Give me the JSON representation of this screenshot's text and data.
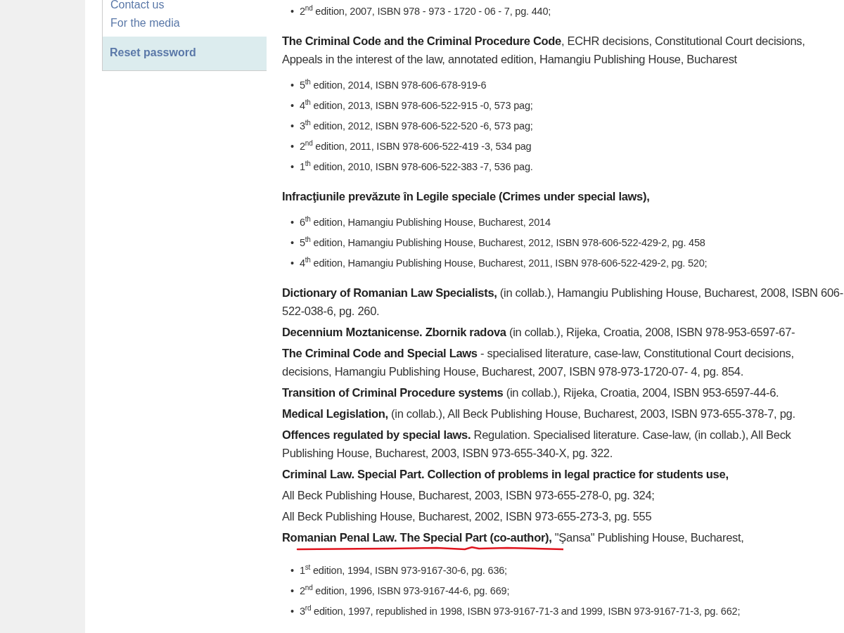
{
  "sidebar": {
    "links": [
      {
        "label": "Contact us"
      },
      {
        "label": "For the media"
      }
    ],
    "reset_link": {
      "label": "Reset password"
    }
  },
  "content": [
    {
      "kind": "list",
      "bullet": "•",
      "items": [
        "2$^{nd}$ edition, 2007, ISBN 978 - 973 - 1720 - 06 - 7, pg. 440;"
      ]
    },
    {
      "kind": "para",
      "text": "**The Criminal Code and the Criminal Procedure Code**, ECHR decisions, Constitutional Court decisions, Appeals in the interest of the law, annotated edition, Hamangiu Publishing House, Bucharest",
      "underlined": false
    },
    {
      "kind": "list",
      "bullet": "•",
      "items": [
        "5$^{th}$ edition, 2014, ISBN 978-606-678-919-6",
        "4$^{th}$ edition, 2013, ISBN 978-606-522-915 -0, 573 pag;",
        "3$^{th}$ edition, 2012,  ISBN 978-606-522-520 -6, 573 pag;",
        "2$^{nd}$ edition, 2011,  ISBN 978-606-522-419 -3, 534 pag",
        "1$^{th}$ edition, 2010,  ISBN 978-606-522-383 -7, 536 pag."
      ]
    },
    {
      "kind": "para",
      "text": "**Infracţiunile prevăzute în Legile speciale (Crimes under special laws),**",
      "underlined": false
    },
    {
      "kind": "list",
      "bullet": "•",
      "items": [
        "6$^{th}$ edition, Hamangiu Publishing House, Bucharest, 2014",
        "5$^{th}$ edition, Hamangiu Publishing House, Bucharest, 2012, ISBN 978-606-522-429-2, pg. 458",
        "4$^{th}$ edition, Hamangiu Publishing House, Bucharest, 2011, ISBN 978-606-522-429-2, pg. 520;"
      ]
    },
    {
      "kind": "para",
      "text": "**Dictionary of Romanian Law Specialists,** (in collab.), Hamangiu Publishing House, Bucharest, 2008, ISBN 606-522-038-6, pg. 260.",
      "underlined": false
    },
    {
      "kind": "para",
      "text": "**Decennium Moztanicense. Zbornik radova** (in collab.), Rijeka, Croatia, 2008, ISBN 978-953-6597-67-",
      "underlined": false
    },
    {
      "kind": "para",
      "text": "**The Criminal Code and Special Laws** - specialised literature, case-law, Constitutional Court decisions, decisions, Hamangiu Publishing House, Bucharest, 2007, ISBN 978-973-1720-07- 4, pg. 854.",
      "underlined": false
    },
    {
      "kind": "para",
      "text": "**Transition of Criminal Procedure systems** (in collab.), Rijeka, Croatia, 2004, ISBN 953-6597-44-6.",
      "underlined": false
    },
    {
      "kind": "para",
      "text": "**Medical Legislation,** (in collab.), All Beck Publishing House, Bucharest, 2003, ISBN 973-655-378-7, pg.",
      "underlined": false
    },
    {
      "kind": "para",
      "text": "**Offences regulated by special laws.** Regulation. Specialised literature. Case-law, (in collab.), All Beck Publishing House, Bucharest, 2003, ISBN 973-655-340-X, pg. 322.",
      "underlined": false
    },
    {
      "kind": "para",
      "text": "**Criminal Law. Special Part. Collection of problems in legal practice for students use,**",
      "underlined": false
    },
    {
      "kind": "para",
      "text": "All Beck Publishing House, Bucharest, 2003,  ISBN 973-655-278-0, pg. 324;",
      "underlined": false
    },
    {
      "kind": "para",
      "text": "All Beck Publishing House, Bucharest, 2002,  ISBN 973-655-273-3, pg. 555",
      "underlined": false
    },
    {
      "kind": "para",
      "text": "**Romanian Penal Law. The Special Part (co-author),** \"Şansa\" Publishing House, Bucharest,",
      "underlined": true
    },
    {
      "kind": "list",
      "bullet": "•",
      "items": [
        "1$^{st}$ edition,  1994, ISBN 973-9167-30-6, pg. 636;",
        "2$^{nd}$ edition, 1996, ISBN 973-9167-44-6, pg. 669;",
        " 3$^{rd}$ edition, 1997, republished in 1998, ISBN 973-9167-71-3 and 1999, ISBN 973-9167-71-3, pg. 662;"
      ]
    }
  ]
}
